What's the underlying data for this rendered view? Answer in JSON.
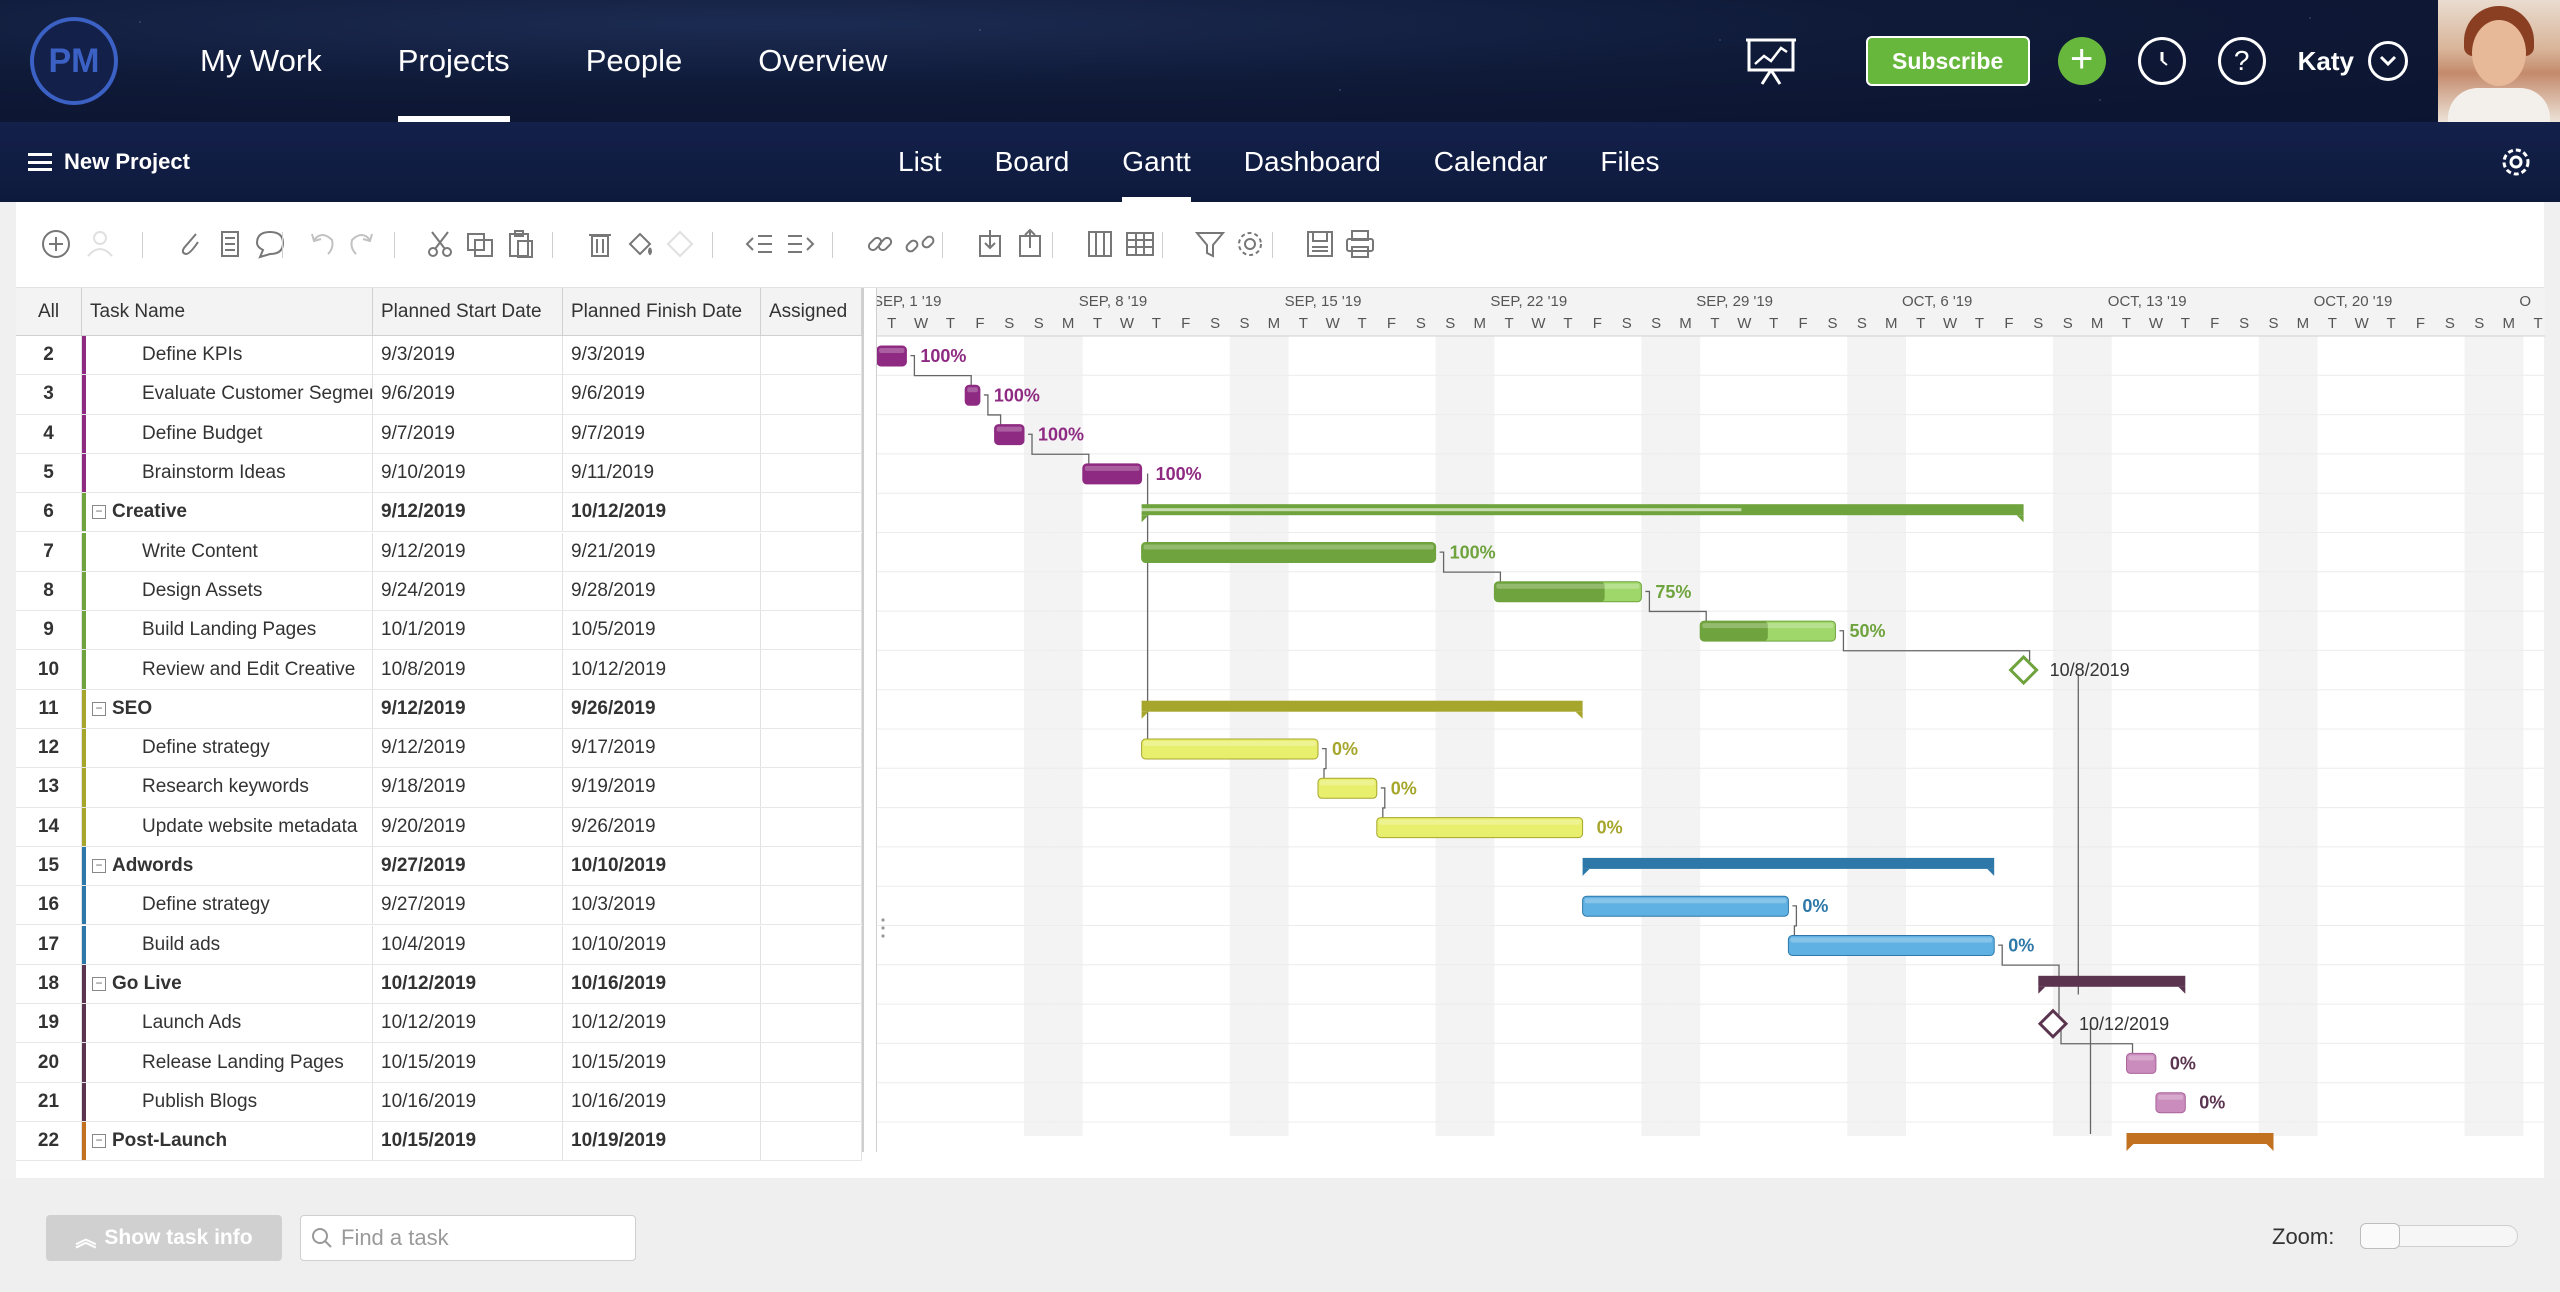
{
  "app": {
    "logo_text": "PM",
    "user_name": "Katy"
  },
  "main_nav": [
    {
      "label": "My Work",
      "active": false
    },
    {
      "label": "Projects",
      "active": true
    },
    {
      "label": "People",
      "active": false
    },
    {
      "label": "Overview",
      "active": false
    }
  ],
  "header": {
    "subscribe_label": "Subscribe",
    "help_label": "?"
  },
  "subbar": {
    "new_project_label": "New Project",
    "tabs": [
      {
        "label": "List",
        "active": false
      },
      {
        "label": "Board",
        "active": false
      },
      {
        "label": "Gantt",
        "active": true
      },
      {
        "label": "Dashboard",
        "active": false
      },
      {
        "label": "Calendar",
        "active": false
      },
      {
        "label": "Files",
        "active": false
      }
    ]
  },
  "toolbar_icons": [
    "add-task-icon",
    "assign-user-icon",
    "attach-icon",
    "notes-icon",
    "comment-icon",
    "undo-icon",
    "redo-icon",
    "cut-icon",
    "copy-icon",
    "paste-icon",
    "delete-icon",
    "fill-color-icon",
    "clear-format-icon",
    "outdent-icon",
    "indent-icon",
    "link-icon",
    "unlink-icon",
    "import-icon",
    "export-icon",
    "columns-icon",
    "grid-icon",
    "filter-icon",
    "settings-icon",
    "save-icon",
    "print-icon"
  ],
  "grid": {
    "headers": {
      "all": "All",
      "name": "Task Name",
      "start": "Planned Start Date",
      "finish": "Planned Finish Date",
      "assigned": "Assigned"
    },
    "rows": [
      {
        "num": "2",
        "name": "Define KPIs",
        "start": "9/3/2019",
        "finish": "9/3/2019",
        "summary": false,
        "color": "#8e2a82"
      },
      {
        "num": "3",
        "name": "Evaluate Customer Segments",
        "start": "9/6/2019",
        "finish": "9/6/2019",
        "summary": false,
        "color": "#8e2a82"
      },
      {
        "num": "4",
        "name": "Define Budget",
        "start": "9/7/2019",
        "finish": "9/7/2019",
        "summary": false,
        "color": "#8e2a82"
      },
      {
        "num": "5",
        "name": "Brainstorm Ideas",
        "start": "9/10/2019",
        "finish": "9/11/2019",
        "summary": false,
        "color": "#8e2a82"
      },
      {
        "num": "6",
        "name": "Creative",
        "start": "9/12/2019",
        "finish": "10/12/2019",
        "summary": true,
        "color": "#6fa33d"
      },
      {
        "num": "7",
        "name": "Write Content",
        "start": "9/12/2019",
        "finish": "9/21/2019",
        "summary": false,
        "color": "#6fa33d"
      },
      {
        "num": "8",
        "name": "Design Assets",
        "start": "9/24/2019",
        "finish": "9/28/2019",
        "summary": false,
        "color": "#6fa33d"
      },
      {
        "num": "9",
        "name": "Build Landing Pages",
        "start": "10/1/2019",
        "finish": "10/5/2019",
        "summary": false,
        "color": "#6fa33d"
      },
      {
        "num": "10",
        "name": "Review and Edit Creative",
        "start": "10/8/2019",
        "finish": "10/12/2019",
        "summary": false,
        "color": "#6fa33d"
      },
      {
        "num": "11",
        "name": "SEO",
        "start": "9/12/2019",
        "finish": "9/26/2019",
        "summary": true,
        "color": "#a6a62c"
      },
      {
        "num": "12",
        "name": "Define strategy",
        "start": "9/12/2019",
        "finish": "9/17/2019",
        "summary": false,
        "color": "#a6a62c"
      },
      {
        "num": "13",
        "name": "Research keywords",
        "start": "9/18/2019",
        "finish": "9/19/2019",
        "summary": false,
        "color": "#a6a62c"
      },
      {
        "num": "14",
        "name": "Update website metadata",
        "start": "9/20/2019",
        "finish": "9/26/2019",
        "summary": false,
        "color": "#a6a62c"
      },
      {
        "num": "15",
        "name": "Adwords",
        "start": "9/27/2019",
        "finish": "10/10/2019",
        "summary": true,
        "color": "#2d78a8"
      },
      {
        "num": "16",
        "name": "Define strategy",
        "start": "9/27/2019",
        "finish": "10/3/2019",
        "summary": false,
        "color": "#2d78a8"
      },
      {
        "num": "17",
        "name": "Build ads",
        "start": "10/4/2019",
        "finish": "10/10/2019",
        "summary": false,
        "color": "#2d78a8"
      },
      {
        "num": "18",
        "name": "Go Live",
        "start": "10/12/2019",
        "finish": "10/16/2019",
        "summary": true,
        "color": "#5b3550"
      },
      {
        "num": "19",
        "name": "Launch Ads",
        "start": "10/12/2019",
        "finish": "10/12/2019",
        "summary": false,
        "color": "#5b3550"
      },
      {
        "num": "20",
        "name": "Release Landing Pages",
        "start": "10/15/2019",
        "finish": "10/15/2019",
        "summary": false,
        "color": "#5b3550"
      },
      {
        "num": "21",
        "name": "Publish Blogs",
        "start": "10/16/2019",
        "finish": "10/16/2019",
        "summary": false,
        "color": "#5b3550"
      },
      {
        "num": "22",
        "name": "Post-Launch",
        "start": "10/15/2019",
        "finish": "10/19/2019",
        "summary": true,
        "color": "#c1711f"
      }
    ]
  },
  "timeline": {
    "start_date": "2019-09-02",
    "weeks": [
      "SEP, 1 '19",
      "SEP, 8 '19",
      "SEP, 15 '19",
      "SEP, 22 '19",
      "SEP, 29 '19",
      "OCT, 6 '19",
      "OCT, 13 '19",
      "OCT, 20 '19",
      "O"
    ],
    "day_letters": [
      "M",
      "T",
      "W",
      "T",
      "F",
      "S",
      "S"
    ]
  },
  "gantt": {
    "bars": [
      {
        "row": 0,
        "start": 0,
        "dur": 1,
        "kind": "task",
        "fill": "#8e2a82",
        "light": "#b94fa9",
        "pct_value": 1.0,
        "pct": "100%",
        "label_color": "#8e2a82"
      },
      {
        "row": 1,
        "start": 3,
        "dur": 0.5,
        "kind": "task",
        "fill": "#8e2a82",
        "light": "#b94fa9",
        "pct_value": 1.0,
        "pct": "100%",
        "label_color": "#8e2a82"
      },
      {
        "row": 2,
        "start": 4,
        "dur": 1,
        "kind": "task",
        "fill": "#8e2a82",
        "light": "#b94fa9",
        "pct_value": 1.0,
        "pct": "100%",
        "label_color": "#8e2a82"
      },
      {
        "row": 3,
        "start": 7,
        "dur": 2,
        "kind": "task",
        "fill": "#8e2a82",
        "light": "#b94fa9",
        "pct_value": 1.0,
        "pct": "100%",
        "label_color": "#8e2a82"
      },
      {
        "row": 4,
        "start": 9,
        "dur": 30,
        "kind": "summary",
        "fill": "#6fa33d",
        "pct_value": 0.68
      },
      {
        "row": 5,
        "start": 9,
        "dur": 10,
        "kind": "task",
        "fill": "#6fa33d",
        "light": "#9dcb6e",
        "pct_value": 1.0,
        "pct": "100%",
        "label_color": "#6fa33d"
      },
      {
        "row": 6,
        "start": 21,
        "dur": 5,
        "kind": "task",
        "fill": "#6fa33d",
        "light": "#9fd76a",
        "pct_value": 0.75,
        "pct": "75%",
        "label_color": "#6fa33d"
      },
      {
        "row": 7,
        "start": 28,
        "dur": 4.6,
        "kind": "task",
        "fill": "#6fa33d",
        "light": "#9fd76a",
        "pct_value": 0.5,
        "pct": "50%",
        "label_color": "#6fa33d"
      },
      {
        "row": 8,
        "start": 39,
        "dur": 0,
        "kind": "milestone",
        "fill": "#6fa33d",
        "label": "10/8/2019"
      },
      {
        "row": 9,
        "start": 9,
        "dur": 15,
        "kind": "summary",
        "fill": "#a6a62c",
        "pct_value": 0
      },
      {
        "row": 10,
        "start": 9,
        "dur": 6,
        "kind": "task",
        "fill": "#a6a62c",
        "light": "#e8ef6c",
        "pct_value": 0,
        "pct": "0%",
        "label_color": "#a6a62c"
      },
      {
        "row": 11,
        "start": 15,
        "dur": 2,
        "kind": "task",
        "fill": "#a6a62c",
        "light": "#e8ef6c",
        "pct_value": 0,
        "pct": "0%",
        "label_color": "#a6a62c"
      },
      {
        "row": 12,
        "start": 17,
        "dur": 7,
        "kind": "task",
        "fill": "#a6a62c",
        "light": "#e8ef6c",
        "pct_value": 0,
        "pct": "0%",
        "label_color": "#a6a62c"
      },
      {
        "row": 13,
        "start": 24,
        "dur": 14,
        "kind": "summary",
        "fill": "#2d78a8",
        "pct_value": 0
      },
      {
        "row": 14,
        "start": 24,
        "dur": 7,
        "kind": "task",
        "fill": "#2d78a8",
        "light": "#5fb0e3",
        "pct_value": 0,
        "pct": "0%",
        "label_color": "#2d78a8"
      },
      {
        "row": 15,
        "start": 31,
        "dur": 7,
        "kind": "task",
        "fill": "#2d78a8",
        "light": "#5fb0e3",
        "pct_value": 0,
        "pct": "0%",
        "label_color": "#2d78a8"
      },
      {
        "row": 16,
        "start": 39.5,
        "dur": 5,
        "kind": "summary",
        "fill": "#5b3550",
        "pct_value": 0
      },
      {
        "row": 17,
        "start": 40,
        "dur": 0,
        "kind": "milestone",
        "fill": "#5b3550",
        "label": "10/12/2019"
      },
      {
        "row": 18,
        "start": 42.5,
        "dur": 1,
        "kind": "task",
        "fill": "#a9649a",
        "light": "#c98cbd",
        "pct_value": 0,
        "pct": "0%",
        "label_color": "#5b3550"
      },
      {
        "row": 19,
        "start": 43.5,
        "dur": 1,
        "kind": "task",
        "fill": "#a9649a",
        "light": "#c98cbd",
        "pct_value": 0,
        "pct": "0%",
        "label_color": "#5b3550"
      },
      {
        "row": 20,
        "start": 42.5,
        "dur": 5,
        "kind": "summary",
        "fill": "#c1711f",
        "pct_value": 0
      }
    ]
  },
  "bottom": {
    "show_task_info": "Show task info",
    "find_placeholder": "Find a task",
    "zoom_label": "Zoom:"
  }
}
